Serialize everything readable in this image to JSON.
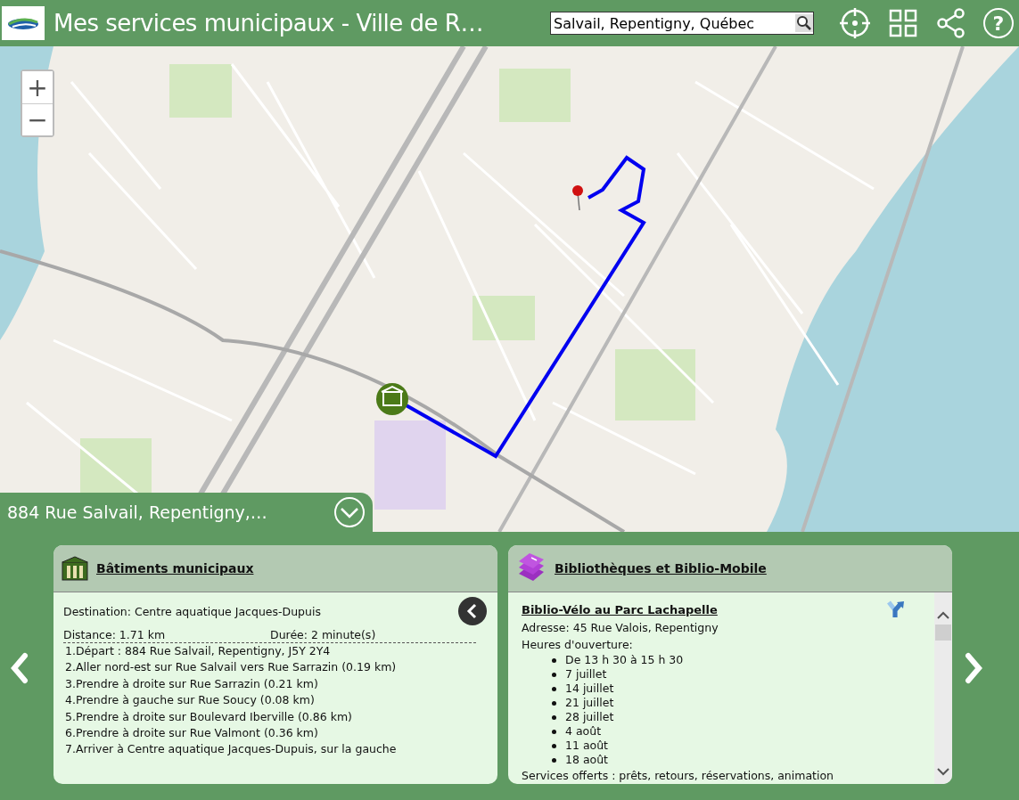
{
  "header": {
    "title": "Mes services municipaux - Ville de R…",
    "search": {
      "value": "Salvail, Repentigny, Québec"
    },
    "help": "?"
  },
  "map": {
    "zoom_in": "+",
    "zoom_out": "−"
  },
  "location_bar": {
    "address": "884 Rue Salvail, Repentigny,…"
  },
  "carousel": {
    "cards": [
      {
        "kind": "directions",
        "title": "Bâtiments municipaux",
        "destination": "Destination: Centre aquatique Jacques-Dupuis",
        "distance": "Distance: 1.71 km",
        "duration": "Durée: 2 minute(s)",
        "steps": [
          "1.Départ : 884 Rue Salvail, Repentigny, J5Y 2Y4",
          "2.Aller nord-est sur Rue Salvail vers Rue Sarrazin (0.19 km)",
          "3.Prendre à droite sur Rue Sarrazin (0.21 km)",
          "4.Prendre à gauche sur Rue Soucy (0.08 km)",
          "5.Prendre à droite sur Boulevard Iberville (0.86 km)",
          "6.Prendre à droite sur Rue Valmont (0.36 km)",
          "7.Arriver à Centre aquatique Jacques-Dupuis, sur la gauche"
        ]
      },
      {
        "kind": "facility",
        "title": "Bibliothèques et Biblio-Mobile",
        "name": "Biblio-Vélo au Parc Lachapelle",
        "address": "Adresse: 45 Rue Valois, Repentigny",
        "hours_label": "Heures d'ouverture:",
        "hours": [
          "De 13 h 30 à 15 h 30",
          "7 juillet",
          "14 juillet",
          "21 juillet",
          "28 juillet",
          "4 août",
          "11 août",
          "18 août"
        ],
        "services": "Services offerts : prêts, retours, réservations, animation"
      }
    ]
  }
}
